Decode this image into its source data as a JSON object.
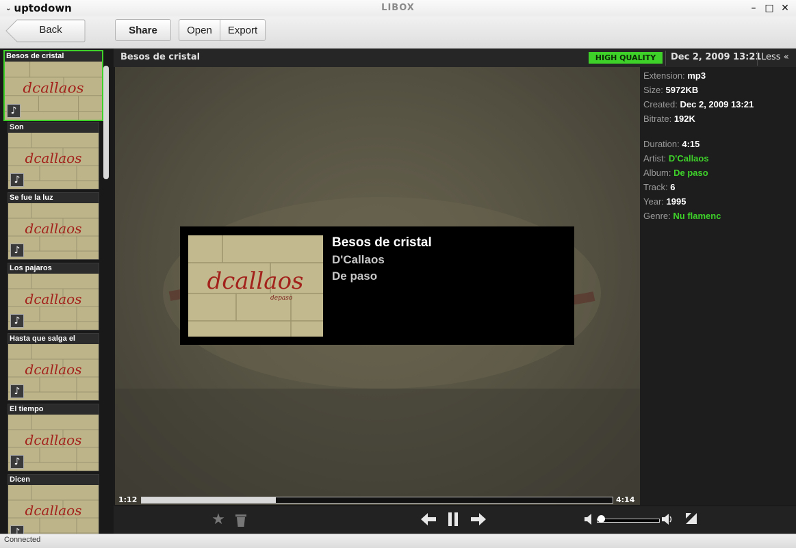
{
  "window": {
    "app_name": "uptodown",
    "title": "LIBOX",
    "minimize": "–",
    "maximize": "□",
    "close": "✕"
  },
  "toolbar": {
    "back_label": "Back",
    "share_label": "Share",
    "open_label": "Open",
    "export_label": "Export"
  },
  "playlist": [
    {
      "title": "Besos de cristal",
      "selected": true
    },
    {
      "title": "Son"
    },
    {
      "title": "Se fue la luz"
    },
    {
      "title": "Los pajaros"
    },
    {
      "title": "Hasta que salga el"
    },
    {
      "title": "El tiempo"
    },
    {
      "title": "Dicen"
    }
  ],
  "topbar": {
    "track_title": "Besos de cristal",
    "quality_badge": "HIGH QUALITY",
    "date": "Dec 2, 2009 13:21",
    "less_label": "Less «"
  },
  "details": [
    {
      "label": "Extension:",
      "value": "mp3"
    },
    {
      "label": "Size:",
      "value": "5972KB"
    },
    {
      "label": "Created:",
      "value": "Dec 2, 2009 13:21"
    },
    {
      "label": "Bitrate:",
      "value": "192K"
    },
    {
      "label": "Duration:",
      "value": "4:15"
    },
    {
      "label": "Artist:",
      "value": "D'Callaos",
      "link": true
    },
    {
      "label": "Album:",
      "value": "De paso",
      "link": true
    },
    {
      "label": "Track:",
      "value": "6"
    },
    {
      "label": "Year:",
      "value": "1995"
    },
    {
      "label": "Genre:",
      "value": "Nu flamenc",
      "link": true
    }
  ],
  "now_playing": {
    "title": "Besos de cristal",
    "artist": "D'Callaos",
    "album": "De paso"
  },
  "playback": {
    "current_time": "1:12",
    "total_time": "4:14",
    "progress_fraction": 0.285,
    "volume_fraction": 0.05
  },
  "icons": {
    "star": "★",
    "trash": "🗑",
    "prev": "🡐",
    "pause": "❚❚",
    "next": "🡒",
    "vol_low": "◀",
    "vol_high": "◀",
    "fullscreen": "⤡",
    "note": "♪",
    "menu": "⌄"
  },
  "status": {
    "text": "Connected"
  },
  "colors": {
    "accent": "#3ed12a",
    "bg": "#1a1a1a"
  }
}
